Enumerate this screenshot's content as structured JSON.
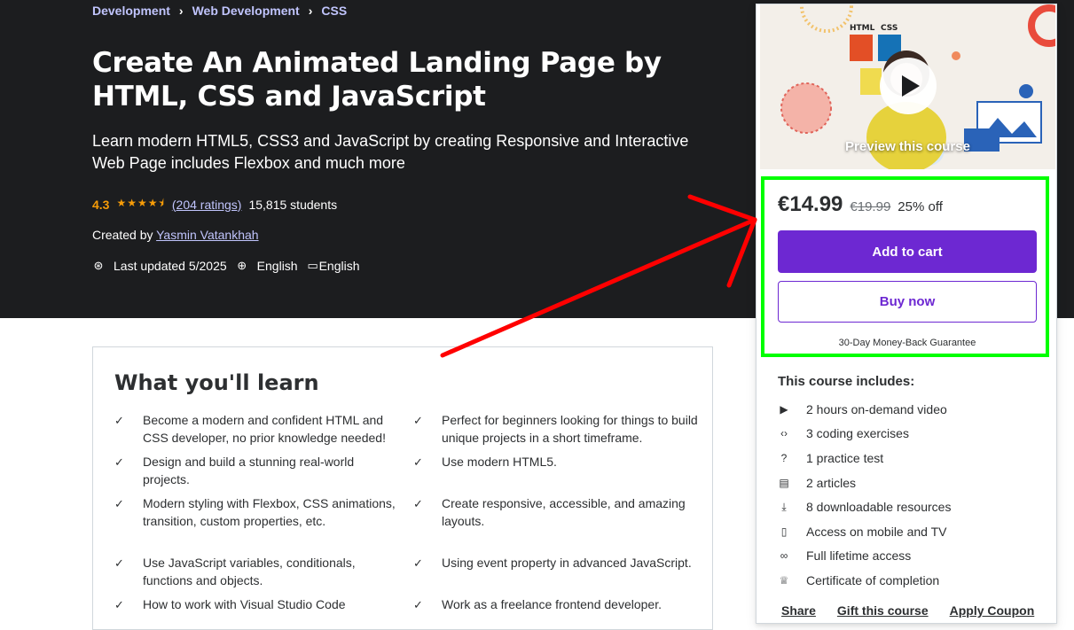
{
  "breadcrumb": [
    "Development",
    "Web Development",
    "CSS"
  ],
  "course": {
    "title": "Create An Animated Landing Page by HTML, CSS and JavaScript",
    "subtitle": "Learn modern HTML5, CSS3 and JavaScript by creating Responsive and Interactive Web Page includes Flexbox and much more",
    "rating": "4.3",
    "stars_value": 4.3,
    "ratings_count": "(204 ratings)",
    "students": "15,815 students",
    "created_by_label": "Created by",
    "instructor": "Yasmin Vatankhah",
    "last_updated": "Last updated 5/2025",
    "language": "English",
    "captions": "English"
  },
  "learn": {
    "title": "What you'll learn",
    "items": [
      "Become a modern and confident HTML and CSS developer, no prior knowledge needed!",
      "Perfect for beginners looking for things to build unique projects in a short timeframe.",
      "Design and build a stunning real-world projects.",
      "Use modern HTML5.",
      "Modern styling with Flexbox, CSS animations, transition, custom properties, etc.",
      "Create responsive, accessible, and amazing layouts.",
      "Use JavaScript variables, conditionals, functions and objects.",
      "Using event property in advanced JavaScript.",
      "How to work with Visual Studio Code",
      "Work as a freelance frontend developer."
    ]
  },
  "sidebar": {
    "preview_label": "Preview this course",
    "price": "€14.99",
    "original_price": "€19.99",
    "discount": "25% off",
    "add_to_cart": "Add to cart",
    "buy_now": "Buy now",
    "guarantee": "30-Day Money-Back Guarantee",
    "includes_title": "This course includes:",
    "includes": [
      {
        "icon": "video-icon",
        "text": "2 hours on-demand video"
      },
      {
        "icon": "code-icon",
        "text": "3 coding exercises"
      },
      {
        "icon": "question-icon",
        "text": "1 practice test"
      },
      {
        "icon": "article-icon",
        "text": "2 articles"
      },
      {
        "icon": "download-icon",
        "text": "8 downloadable resources"
      },
      {
        "icon": "mobile-icon",
        "text": "Access on mobile and TV"
      },
      {
        "icon": "infinity-icon",
        "text": "Full lifetime access"
      },
      {
        "icon": "trophy-icon",
        "text": "Certificate of completion"
      }
    ],
    "footer_links": [
      "Share",
      "Gift this course",
      "Apply Coupon"
    ]
  },
  "colors": {
    "hero_bg": "#1c1d1f",
    "accent_purple": "#6d28d2",
    "link_lavender": "#c0c4fc",
    "star_orange": "#f69c08",
    "highlight_green": "#00ff00",
    "arrow_red": "#ff0000"
  }
}
